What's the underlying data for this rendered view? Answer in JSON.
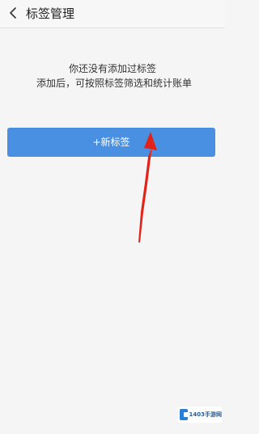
{
  "header": {
    "title": "标签管理",
    "back_icon": "chevron-left-icon"
  },
  "empty_state": {
    "line1": "你还没有添加过标签",
    "line2": "添加后，可按照标签筛选和统计账单"
  },
  "add_button": {
    "label": "+新标签",
    "color": "#4a90e2"
  },
  "annotation_arrow": {
    "color": "#e2231a"
  },
  "watermark": {
    "text": "1403手游网"
  }
}
